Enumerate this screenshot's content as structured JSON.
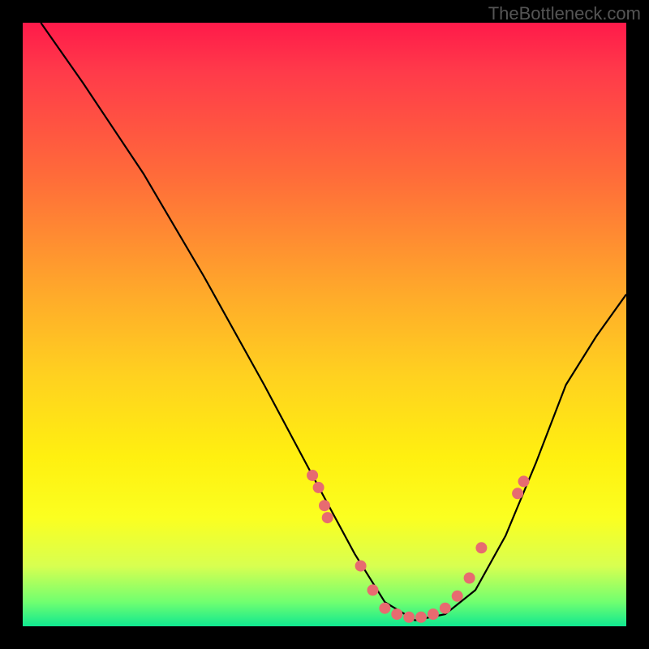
{
  "watermark": "TheBottleneck.com",
  "chart_data": {
    "type": "line",
    "title": "",
    "xlabel": "",
    "ylabel": "",
    "xlim": [
      0,
      100
    ],
    "ylim": [
      0,
      100
    ],
    "curve": {
      "x": [
        3,
        10,
        20,
        30,
        40,
        48,
        55,
        60,
        65,
        70,
        75,
        80,
        85,
        90,
        95,
        100
      ],
      "y": [
        100,
        90,
        75,
        58,
        40,
        25,
        12,
        4,
        1,
        2,
        6,
        15,
        27,
        40,
        48,
        55
      ]
    },
    "markers": {
      "x": [
        48,
        49,
        50,
        50.5,
        56,
        58,
        60,
        62,
        64,
        66,
        68,
        70,
        72,
        74,
        76,
        82,
        83
      ],
      "y": [
        25,
        23,
        20,
        18,
        10,
        6,
        3,
        2,
        1.5,
        1.5,
        2,
        3,
        5,
        8,
        13,
        22,
        24
      ],
      "color": "#e76b70",
      "radius": 7
    }
  }
}
